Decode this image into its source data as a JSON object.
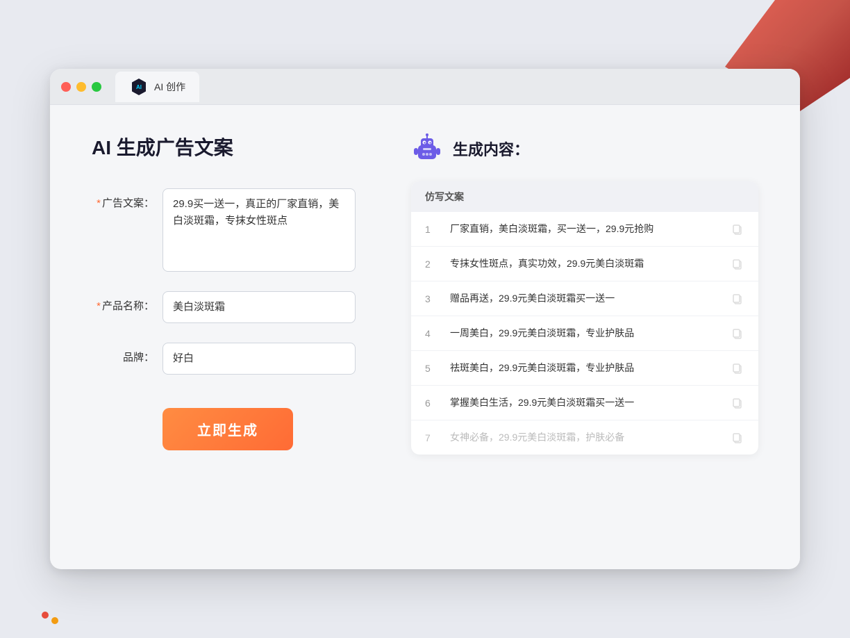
{
  "window": {
    "tab_label": "AI 创作",
    "controls": {
      "close": "close",
      "minimize": "minimize",
      "maximize": "maximize"
    }
  },
  "left_panel": {
    "title": "AI 生成广告文案",
    "form": {
      "ad_copy_label": "广告文案：",
      "ad_copy_required": "*",
      "ad_copy_value": "29.9买一送一，真正的厂家直销，美白淡斑霜，专抹女性斑点",
      "product_name_label": "产品名称：",
      "product_name_required": "*",
      "product_name_value": "美白淡斑霜",
      "brand_label": "品牌：",
      "brand_value": "好白",
      "generate_button": "立即生成"
    }
  },
  "right_panel": {
    "result_title": "生成内容：",
    "table_header": "仿写文案",
    "results": [
      {
        "num": "1",
        "text": "厂家直销，美白淡斑霜，买一送一，29.9元抢购",
        "faded": false
      },
      {
        "num": "2",
        "text": "专抹女性斑点，真实功效，29.9元美白淡斑霜",
        "faded": false
      },
      {
        "num": "3",
        "text": "赠品再送，29.9元美白淡斑霜买一送一",
        "faded": false
      },
      {
        "num": "4",
        "text": "一周美白，29.9元美白淡斑霜，专业护肤品",
        "faded": false
      },
      {
        "num": "5",
        "text": "祛斑美白，29.9元美白淡斑霜，专业护肤品",
        "faded": false
      },
      {
        "num": "6",
        "text": "掌握美白生活，29.9元美白淡斑霜买一送一",
        "faded": false
      },
      {
        "num": "7",
        "text": "女神必备，29.9元美白淡斑霜，护肤必备",
        "faded": true
      }
    ]
  }
}
